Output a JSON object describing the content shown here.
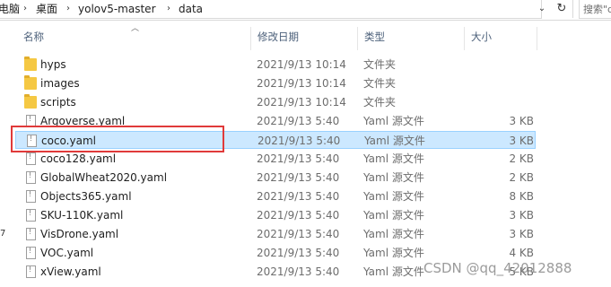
{
  "address_bar": {
    "crumbs": [
      "电脑",
      "桌面",
      "yolov5-master",
      "data"
    ],
    "search_placeholder": "搜索\"d"
  },
  "columns": {
    "name": "名称",
    "date": "修改日期",
    "type": "类型",
    "size": "大小"
  },
  "rows": [
    {
      "name": "hyps",
      "date": "2021/9/13 10:14",
      "type": "文件夹",
      "size": "",
      "icon": "folder-icon"
    },
    {
      "name": "images",
      "date": "2021/9/13 10:14",
      "type": "文件夹",
      "size": "",
      "icon": "folder-icon"
    },
    {
      "name": "scripts",
      "date": "2021/9/13 10:14",
      "type": "文件夹",
      "size": "",
      "icon": "folder-icon"
    },
    {
      "name": "Argoverse.yaml",
      "date": "2021/9/13 5:40",
      "type": "Yaml 源文件",
      "size": "3 KB",
      "icon": "yaml-file-icon"
    },
    {
      "name": "coco.yaml",
      "date": "2021/9/13 5:40",
      "type": "Yaml 源文件",
      "size": "3 KB",
      "icon": "yaml-file-icon",
      "selected": true
    },
    {
      "name": "coco128.yaml",
      "date": "2021/9/13 5:40",
      "type": "Yaml 源文件",
      "size": "2 KB",
      "icon": "yaml-file-icon"
    },
    {
      "name": "GlobalWheat2020.yaml",
      "date": "2021/9/13 5:40",
      "type": "Yaml 源文件",
      "size": "2 KB",
      "icon": "yaml-file-icon"
    },
    {
      "name": "Objects365.yaml",
      "date": "2021/9/13 5:40",
      "type": "Yaml 源文件",
      "size": "8 KB",
      "icon": "yaml-file-icon"
    },
    {
      "name": "SKU-110K.yaml",
      "date": "2021/9/13 5:40",
      "type": "Yaml 源文件",
      "size": "3 KB",
      "icon": "yaml-file-icon"
    },
    {
      "name": "VisDrone.yaml",
      "date": "2021/9/13 5:40",
      "type": "Yaml 源文件",
      "size": "3 KB",
      "icon": "yaml-file-icon"
    },
    {
      "name": "VOC.yaml",
      "date": "2021/9/13 5:40",
      "type": "Yaml 源文件",
      "size": "4 KB",
      "icon": "yaml-file-icon"
    },
    {
      "name": "xView.yaml",
      "date": "2021/9/13 5:40",
      "type": "Yaml 源文件",
      "size": "5 KB",
      "icon": "yaml-file-icon"
    }
  ],
  "left_nav_fragment": "7",
  "watermark": "CSDN @qq_42012888",
  "colors": {
    "selection_bg": "#cce8ff",
    "selection_border": "#99d1ff",
    "highlight_box": "#e03a3a",
    "folder": "#f5c843"
  }
}
